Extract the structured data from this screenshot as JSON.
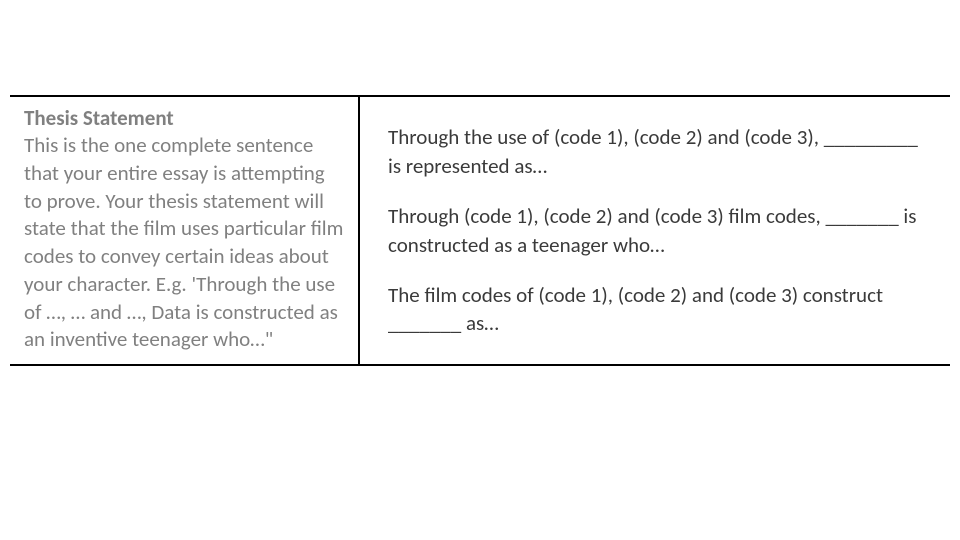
{
  "table": {
    "left": {
      "heading": "Thesis Statement",
      "body": "This is the one complete sentence that your entire essay is attempting to prove. Your thesis statement will state that the film uses particular film codes to convey certain ideas about your character. E.g. 'Through the use of …, … and …, Data is constructed as an inventive teenager who…\""
    },
    "right": {
      "p1": "Through the use of (code 1), (code 2) and (code 3), _________ is represented as…",
      "p2": "Through (code 1), (code 2) and (code 3) film codes, _______ is constructed as a teenager who…",
      "p3": "The film codes of (code 1), (code 2) and (code 3) construct _______ as…"
    }
  }
}
